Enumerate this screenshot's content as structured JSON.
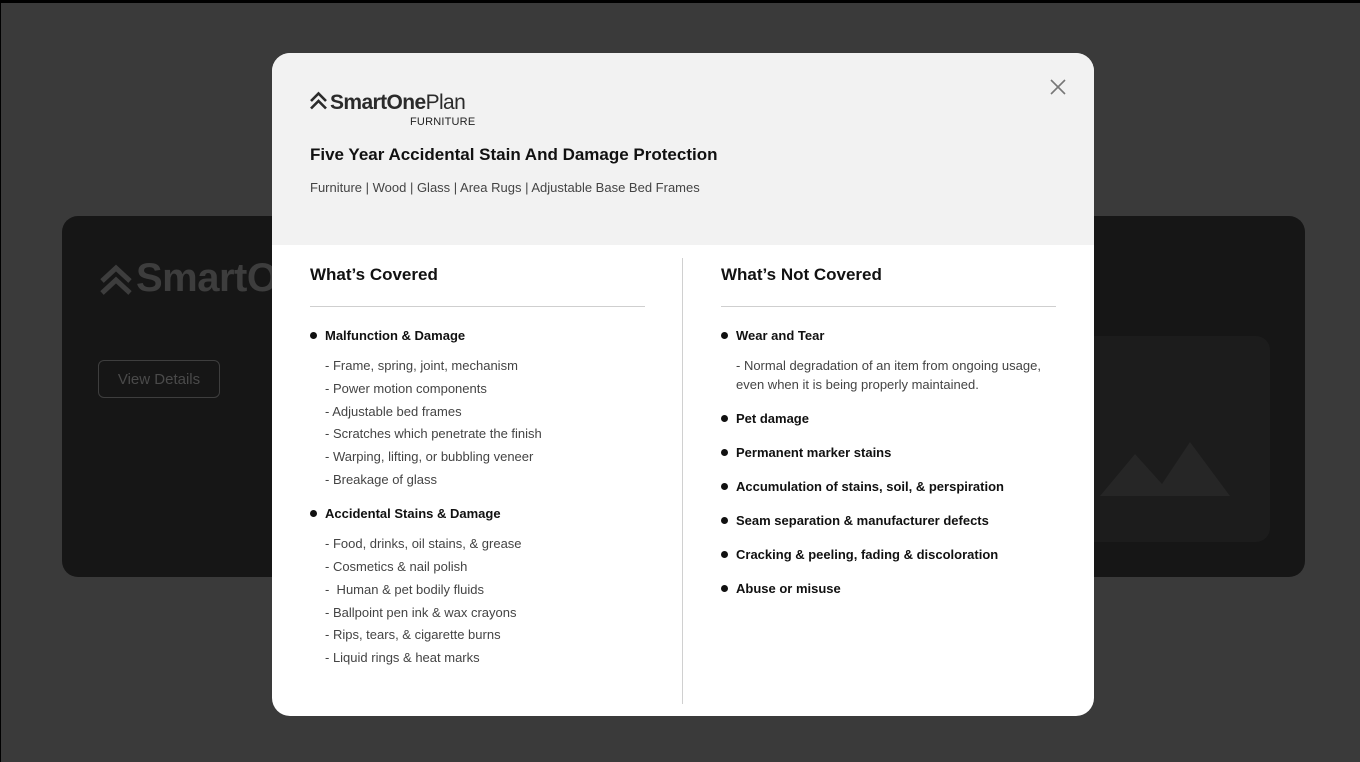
{
  "background": {
    "logo_text": "SmartO",
    "view_details_label": "View Details"
  },
  "modal": {
    "brand": {
      "name_bold": "SmartOne",
      "name_light": "Plan",
      "sub": "FURNITURE"
    },
    "title": "Five Year Accidental Stain And Damage Protection",
    "subtitle": "Furniture | Wood | Glass | Area Rugs | Adjustable Base Bed Frames",
    "covered": {
      "heading": "What’s Covered",
      "groups": [
        {
          "label": "Malfunction & Damage",
          "items": [
            "- Frame, spring, joint, mechanism",
            "- Power motion components",
            "- Adjustable bed frames",
            "- Scratches which penetrate the finish",
            "- Warping, lifting, or bubbling veneer",
            "- Breakage of glass"
          ]
        },
        {
          "label": "Accidental Stains & Damage",
          "items": [
            "- Food, drinks, oil stains, & grease",
            "- Cosmetics & nail polish",
            "-  Human & pet bodily fluids",
            "- Ballpoint pen ink & wax crayons",
            "- Rips, tears, & cigarette burns",
            "- Liquid rings & heat marks"
          ]
        }
      ]
    },
    "not_covered": {
      "heading": "What’s Not Covered",
      "items": [
        {
          "label": "Wear and Tear",
          "detail": "- Normal degradation of an item from ongoing usage, even when it is being properly maintained."
        },
        {
          "label": "Pet damage"
        },
        {
          "label": "Permanent marker stains"
        },
        {
          "label": "Accumulation of stains, soil, & perspiration"
        },
        {
          "label": "Seam separation & manufacturer defects"
        },
        {
          "label": "Cracking & peeling, fading & discoloration"
        },
        {
          "label": "Abuse or misuse"
        }
      ]
    }
  }
}
